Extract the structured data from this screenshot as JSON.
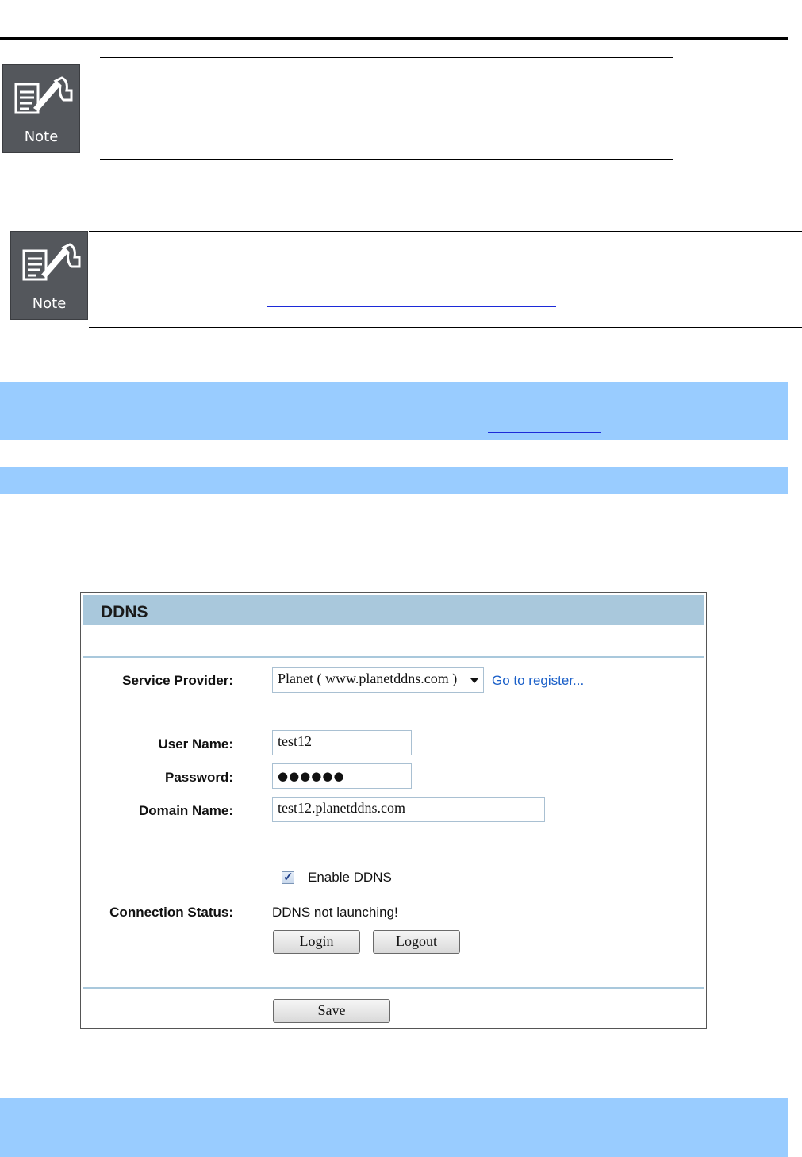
{
  "notes": [
    {
      "icon": "note-icon",
      "label": "Note"
    },
    {
      "icon": "note-icon",
      "label": "Note"
    }
  ],
  "ddns": {
    "title": "DDNS",
    "service_provider_label": "Service Provider:",
    "service_provider_value": "Planet ( www.planetddns.com )",
    "register_link": "Go to register...",
    "user_name_label": "User Name:",
    "user_name_value": "test12",
    "password_label": "Password:",
    "password_value": "●●●●●●",
    "domain_name_label": "Domain Name:",
    "domain_name_value": "test12.planetddns.com",
    "enable_label": "Enable DDNS",
    "enable_checked": true,
    "connection_status_label": "Connection Status:",
    "connection_status_value": "DDNS not launching!",
    "login_button": "Login",
    "logout_button": "Logout",
    "save_button": "Save"
  },
  "colors": {
    "band_blue": "#99ccff",
    "panel_header": "#a9c8dc",
    "link_blue": "#1a5fc8"
  }
}
